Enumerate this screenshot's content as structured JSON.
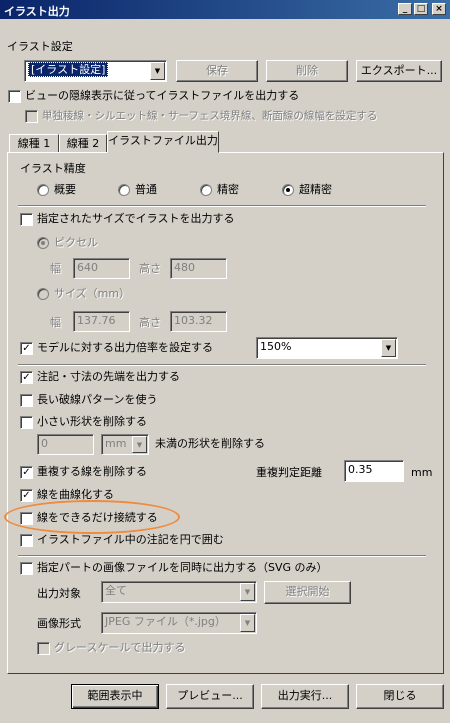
{
  "window": {
    "title": "イラスト出力",
    "min_icon": "_",
    "max_icon": "□",
    "close_icon": "×"
  },
  "settings": {
    "label": "イラスト設定",
    "dropdown_value": "[イラスト設定]",
    "save_label": "保存",
    "delete_label": "削除",
    "export_label": "エクスポート..."
  },
  "hidden_lines": {
    "label": "ビューの隠線表示に従ってイラストファイルを出力する",
    "sub_label": "単独稜線・シルエット線・サーフェス境界線、断面線の線幅を設定する"
  },
  "tabs": [
    {
      "label": "線種 1"
    },
    {
      "label": "線種 2"
    },
    {
      "label": "イラストファイル出力"
    }
  ],
  "precision": {
    "label": "イラスト精度",
    "options": [
      "概要",
      "普通",
      "精密",
      "超精密"
    ],
    "selected": "超精密"
  },
  "size_output": {
    "label": "指定されたサイズでイラストを出力する",
    "pixel_label": "ピクセル",
    "width_label": "幅",
    "height_label": "高さ",
    "pixel_width": "640",
    "pixel_height": "480",
    "mm_label": "サイズ（mm）",
    "mm_width": "137.76",
    "mm_height": "103.32"
  },
  "scale": {
    "label": "モデルに対する出力倍率を設定する",
    "value": "150%"
  },
  "options": {
    "annotation_tips": "注記・寸法の先端を出力する",
    "long_dash": "長い破線パターンを使う",
    "remove_small": "小さい形状を削除する",
    "small_value": "0",
    "small_unit": "mm",
    "small_suffix": "未満の形状を削除する",
    "remove_duplicates": "重複する線を削除する",
    "dup_distance_label": "重複判定距離",
    "dup_distance_value": "0.35",
    "dup_distance_unit": "mm",
    "curve_lines": "線を曲線化する",
    "connect_lines": "線をできるだけ接続する",
    "circle_notes": "イラストファイル中の注記を円で囲む"
  },
  "part_image": {
    "label": "指定パートの画像ファイルを同時に出力する（SVG のみ）",
    "target_label": "出力対象",
    "target_value": "全て",
    "select_start": "選択開始",
    "format_label": "画像形式",
    "format_value": "JPEG ファイル（*.jpg）",
    "grayscale": "グレースケールで出力する"
  },
  "footer": {
    "range_label": "範囲表示中",
    "preview_label": "プレビュー...",
    "execute_label": "出力実行...",
    "close_label": "閉じる"
  },
  "colors": {
    "highlight": "#f08a3c",
    "title_start": "#0a246a",
    "title_end": "#3a6ea5"
  }
}
